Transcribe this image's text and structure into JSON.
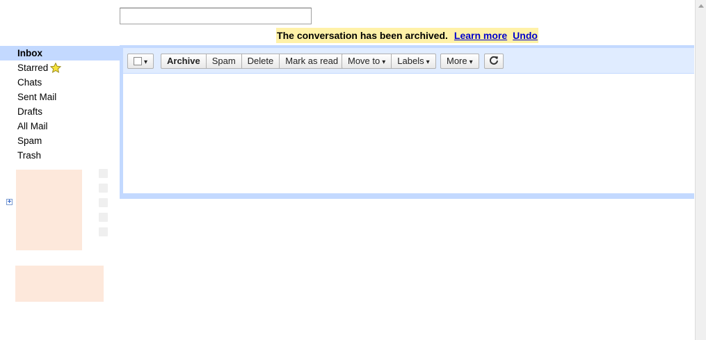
{
  "search": {
    "value": ""
  },
  "notice": {
    "message": "The conversation has been archived.",
    "learn_more": "Learn more",
    "undo": "Undo"
  },
  "nav": {
    "items": [
      {
        "label": "Inbox"
      },
      {
        "label": "Starred"
      },
      {
        "label": "Chats"
      },
      {
        "label": "Sent Mail"
      },
      {
        "label": "Drafts"
      },
      {
        "label": "All Mail"
      },
      {
        "label": "Spam"
      },
      {
        "label": "Trash"
      }
    ]
  },
  "toolbar": {
    "archive": "Archive",
    "spam": "Spam",
    "delete": "Delete",
    "mark_as_read": "Mark as read",
    "move_to": "Move to",
    "labels": "Labels",
    "more": "More",
    "caret": "▾"
  },
  "colors": {
    "nav_selected": "#c3d9ff",
    "toolbar_bg": "#e0ecff",
    "notice_bg": "#fff1a8",
    "gadget_bg": "#fde8db",
    "link": "#0000cc"
  },
  "icons": {
    "starred": "star-icon",
    "refresh": "refresh-icon",
    "expand": "plus-icon"
  }
}
